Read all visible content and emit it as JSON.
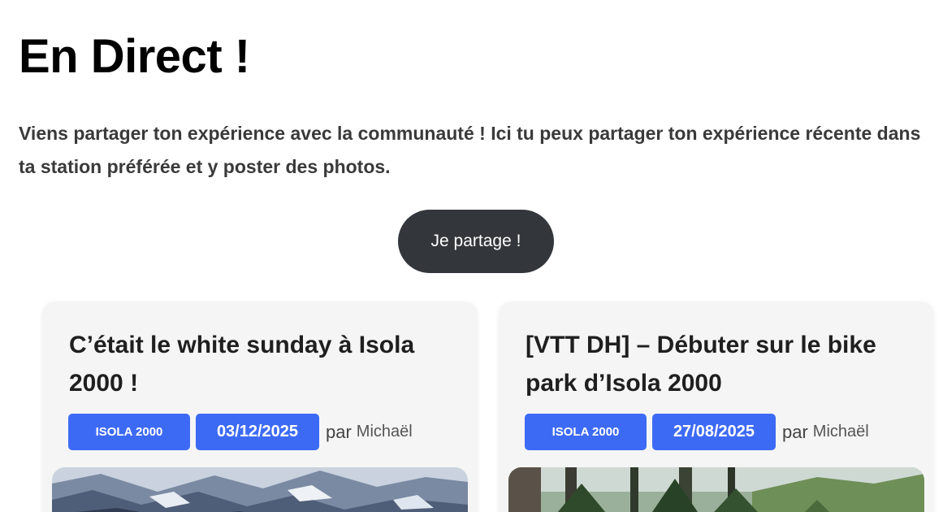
{
  "page": {
    "title": "En Direct !",
    "intro": "Viens partager ton expérience avec la communauté ! Ici tu peux partager ton expérience récente dans ta station préférée et y poster des photos.",
    "cta_label": "Je partage !"
  },
  "posts": [
    {
      "title": "C’était le white sunday à Isola 2000 !",
      "category": "ISOLA 2000",
      "date": "03/12/2025",
      "by_label": "par",
      "author": "Michaël"
    },
    {
      "title": "[VTT DH] – Débuter sur le bike park d’Isola 2000",
      "category": "ISOLA 2000",
      "date": "27/08/2025",
      "by_label": "par",
      "author": "Michaël"
    }
  ],
  "colors": {
    "accent": "#3d6af5",
    "cta_bg": "#33373c",
    "card_bg": "#f5f5f5"
  }
}
